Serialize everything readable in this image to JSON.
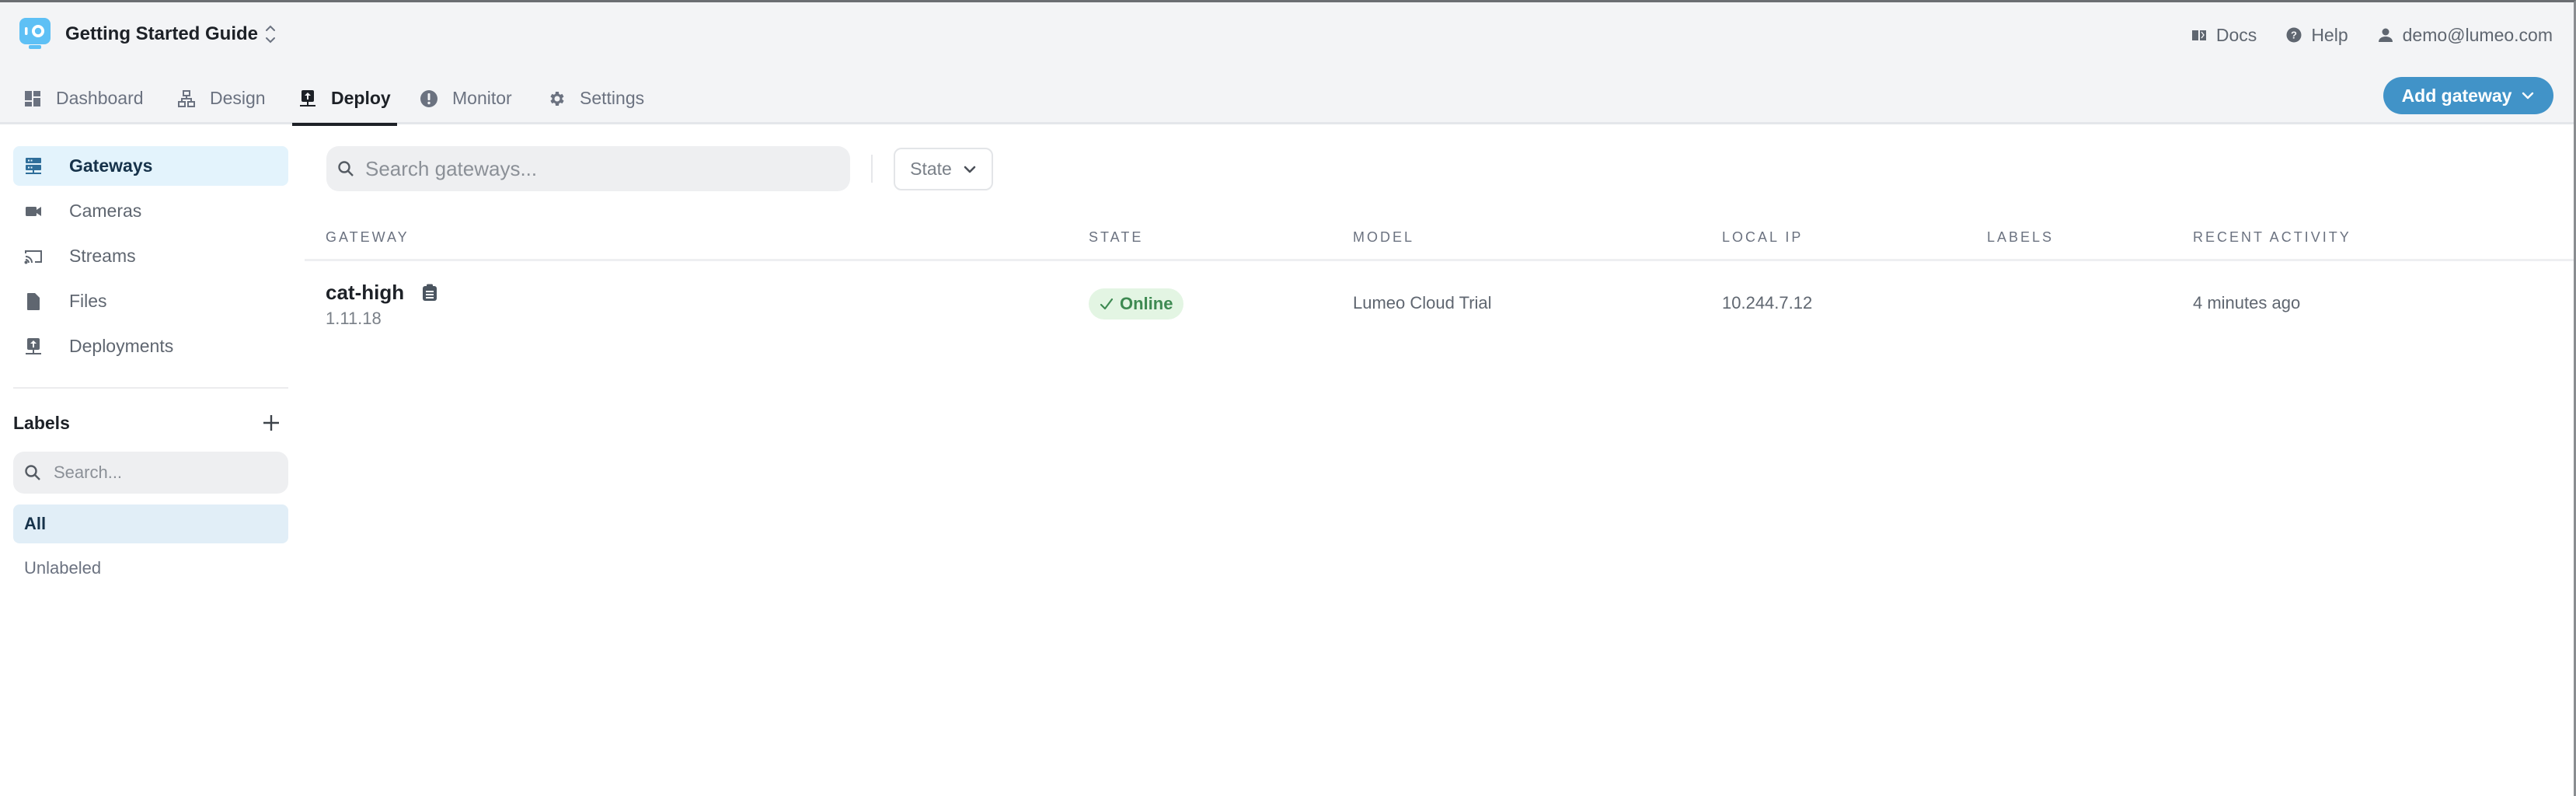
{
  "header": {
    "project_title": "Getting Started Guide",
    "tabs": [
      {
        "label": "Dashboard",
        "icon": "dashboard-icon",
        "active": false
      },
      {
        "label": "Design",
        "icon": "sitemap-icon",
        "active": false
      },
      {
        "label": "Deploy",
        "icon": "deploy-icon",
        "active": true
      },
      {
        "label": "Monitor",
        "icon": "alert-circle-icon",
        "active": false
      },
      {
        "label": "Settings",
        "icon": "gear-icon",
        "active": false
      }
    ],
    "links": {
      "docs": "Docs",
      "help": "Help",
      "user": "demo@lumeo.com"
    },
    "add_button_label": "Add gateway"
  },
  "sidebar": {
    "items": [
      {
        "label": "Gateways",
        "icon": "server-icon",
        "active": true
      },
      {
        "label": "Cameras",
        "icon": "camera-icon",
        "active": false
      },
      {
        "label": "Streams",
        "icon": "cast-icon",
        "active": false
      },
      {
        "label": "Files",
        "icon": "file-icon",
        "active": false
      },
      {
        "label": "Deployments",
        "icon": "deploy-icon",
        "active": false
      }
    ],
    "labels": {
      "title": "Labels",
      "search_placeholder": "Search...",
      "items": [
        {
          "label": "All",
          "active": true
        },
        {
          "label": "Unlabeled",
          "active": false
        }
      ]
    }
  },
  "main": {
    "search_placeholder": "Search gateways...",
    "state_filter_label": "State",
    "columns": [
      "Gateway",
      "State",
      "Model",
      "Local IP",
      "Labels",
      "Recent Activity"
    ],
    "rows": [
      {
        "name": "cat-high",
        "version": "1.11.18",
        "state": "Online",
        "model": "Lumeo Cloud Trial",
        "local_ip": "10.244.7.12",
        "labels": "",
        "recent_activity": "4 minutes ago"
      }
    ]
  },
  "colors": {
    "accent": "#4193c8",
    "header_bg": "#f3f4f6",
    "active_sidebar_bg": "#e3f3fc",
    "online_badge_bg": "#e3f5e3",
    "online_badge_text": "#3e8a52",
    "logo": "#5ec0f5"
  }
}
